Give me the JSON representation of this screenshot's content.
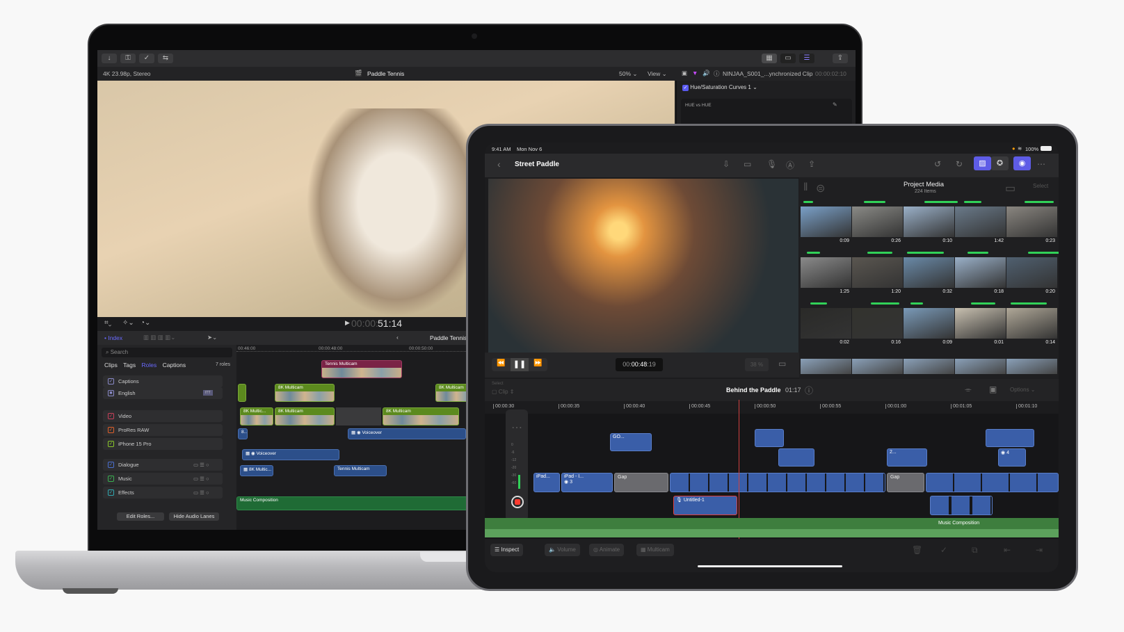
{
  "macbook": {
    "toolbar": {
      "left_icons": [
        "import-icon",
        "keyword-icon",
        "checkmark-icon",
        "background-tasks-icon"
      ],
      "right_icons": [
        "browser-layout-icon",
        "timeline-layout-icon",
        "inspector-icon",
        "share-icon"
      ]
    },
    "infobar": {
      "format": "4K 23.98p, Stereo",
      "project_title": "Paddle Tennis",
      "zoom": "50%",
      "view_menu": "View",
      "clip_name": "NINJAA_S001_...ynchronized Clip",
      "clip_timecode": "00:00:02:10"
    },
    "inspector": {
      "effect_name": "Hue/Saturation Curves 1",
      "curve_label": "HUE vs HUE"
    },
    "viewer_bar": {
      "timecode_dim": "00:00:",
      "timecode": "51:14"
    },
    "library": {
      "index_label": "Index",
      "timeline_title": "Paddle Tennis",
      "search_placeholder": "Search",
      "tabs": [
        "Clips",
        "Tags",
        "Roles",
        "Captions"
      ],
      "active_tab": "Roles",
      "roles_count": "7 roles",
      "roles": [
        {
          "label": "Captions",
          "color": "#8a8ac8"
        },
        {
          "label": "English",
          "color": "#8a8ac8",
          "badge": "ITT"
        },
        {
          "label": "Video",
          "color": "#c8405a"
        },
        {
          "label": "ProRes RAW",
          "color": "#e0602a"
        },
        {
          "label": "iPhone 15 Pro",
          "color": "#8ac82a"
        },
        {
          "label": "Dialogue",
          "color": "#4a70d0"
        },
        {
          "label": "Music",
          "color": "#3ab050"
        },
        {
          "label": "Effects",
          "color": "#30a8b0"
        }
      ],
      "edit_roles_button": "Edit Roles...",
      "hide_audio_lanes_button": "Hide Audio Lanes"
    },
    "timeline": {
      "ruler": [
        "00:46:00",
        "00:00:48:00",
        "00:00:50:00"
      ],
      "clips": {
        "tennis_multicam": "Tennis Multicam",
        "multicam_8k": "8K Multicam",
        "multicam_8k_short": "8K Multic...",
        "voiceover": "Voiceover",
        "dialogue_short": "8...",
        "tennis_multicam_audio": "Tennis Multicam",
        "music": "Music Composition"
      }
    }
  },
  "ipad": {
    "status": {
      "time": "9:41 AM",
      "date": "Mon Nov 6",
      "battery": "100%"
    },
    "nav": {
      "title": "Street Paddle"
    },
    "media": {
      "title": "Project Media",
      "count": "224 Items",
      "select": "Select",
      "durations": [
        "0:09",
        "0:26",
        "0:10",
        "1:42",
        "0:23",
        "1:25",
        "1:20",
        "0:32",
        "0:18",
        "0:20",
        "0:02",
        "0:16",
        "0:09",
        "0:01",
        "0:14"
      ]
    },
    "controls": {
      "timecode_prefix": "00:",
      "timecode_main": "00:48",
      "timecode_frames": ":19",
      "zoom": "38",
      "zoom_unit": "%"
    },
    "timeline_header": {
      "select_label": "Select",
      "clip_label": "Clip",
      "project": "Behind the Paddle",
      "duration": "01:17",
      "options": "Options"
    },
    "ruler": [
      "00:00:30",
      "00:00:35",
      "00:00:40",
      "00:00:45",
      "00:00:50",
      "00:00:55",
      "00:01:00",
      "00:01:05",
      "00:01:10"
    ],
    "meter_scale": [
      "0",
      "-6",
      "-12",
      "-20",
      "-30",
      "-60"
    ],
    "clips": {
      "ipad1": "iPad...",
      "ipad2": "iPad - I...",
      "gap": "Gap",
      "go": "GO...",
      "two": "2...",
      "untitled": "Untitled-1",
      "music": "Music Composition",
      "angles3": "3",
      "angles4": "4"
    },
    "bottom": {
      "inspect": "Inspect",
      "volume": "Volume",
      "animate": "Animate",
      "multicam": "Multicam"
    }
  }
}
